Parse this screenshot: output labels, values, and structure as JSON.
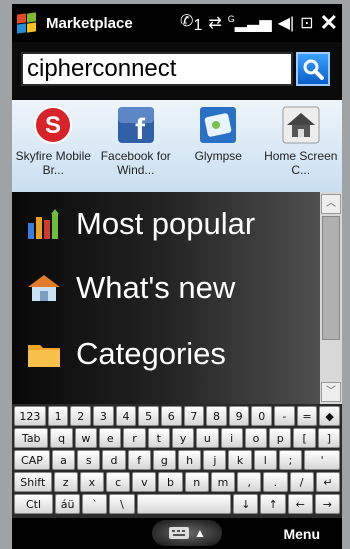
{
  "statusbar": {
    "title": "Marketplace",
    "signal_label": "G",
    "call_badge": "1"
  },
  "search": {
    "value": "cipherconnect"
  },
  "featured_apps": [
    {
      "label": "Skyfire Mobile Br...",
      "icon": "skyfire-icon",
      "color": "#d8232a"
    },
    {
      "label": "Facebook for Wind...",
      "icon": "facebook-icon",
      "color": "#2f5fa5"
    },
    {
      "label": "Glympse",
      "icon": "glympse-icon",
      "color": "#2a70c7"
    },
    {
      "label": "Home Screen C...",
      "icon": "home-icon",
      "color": "#555555"
    }
  ],
  "menu": {
    "items": [
      {
        "label": "Most popular",
        "icon": "bar-chart-icon"
      },
      {
        "label": "What's new",
        "icon": "new-house-icon"
      },
      {
        "label": "Categories",
        "icon": "folder-icon"
      }
    ]
  },
  "keyboard": {
    "rows": [
      [
        "123",
        "1",
        "2",
        "3",
        "4",
        "5",
        "6",
        "7",
        "8",
        "9",
        "0",
        "-",
        "=",
        "◆"
      ],
      [
        "Tab",
        "q",
        "w",
        "e",
        "r",
        "t",
        "y",
        "u",
        "i",
        "o",
        "p",
        "[",
        "]"
      ],
      [
        "CAP",
        "a",
        "s",
        "d",
        "f",
        "g",
        "h",
        "j",
        "k",
        "l",
        ";",
        "'"
      ],
      [
        "Shift",
        "z",
        "x",
        "c",
        "v",
        "b",
        "n",
        "m",
        ",",
        ".",
        "/",
        "↵"
      ],
      [
        "Ctl",
        "áü",
        "`",
        "\\",
        " ",
        "↓",
        "↑",
        "←",
        "→"
      ]
    ]
  },
  "bottombar": {
    "menu_label": "Menu"
  }
}
